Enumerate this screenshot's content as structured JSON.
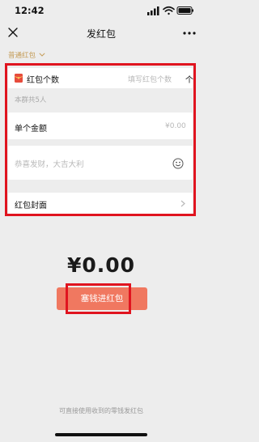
{
  "status_bar": {
    "time": "12:42"
  },
  "nav": {
    "title": "发红包"
  },
  "packet_type": {
    "label": "普通红包"
  },
  "count_row": {
    "label": "红包个数",
    "placeholder": "填写红包个数",
    "unit": "个"
  },
  "group_note": "本群共5人",
  "amount_row": {
    "label": "单个金额",
    "placeholder": "¥0.00"
  },
  "message_row": {
    "placeholder": "恭喜发财，大吉大利"
  },
  "cover_row": {
    "label": "红包封面"
  },
  "total_amount": "¥0.00",
  "submit_button": {
    "label": "塞钱进红包"
  },
  "footer_note": "可直接使用收到的零钱发红包",
  "colors": {
    "highlight": "#e0141f",
    "button": "#f07860",
    "type_accent": "#c49b55",
    "packet_icon": "#e74c3c"
  }
}
